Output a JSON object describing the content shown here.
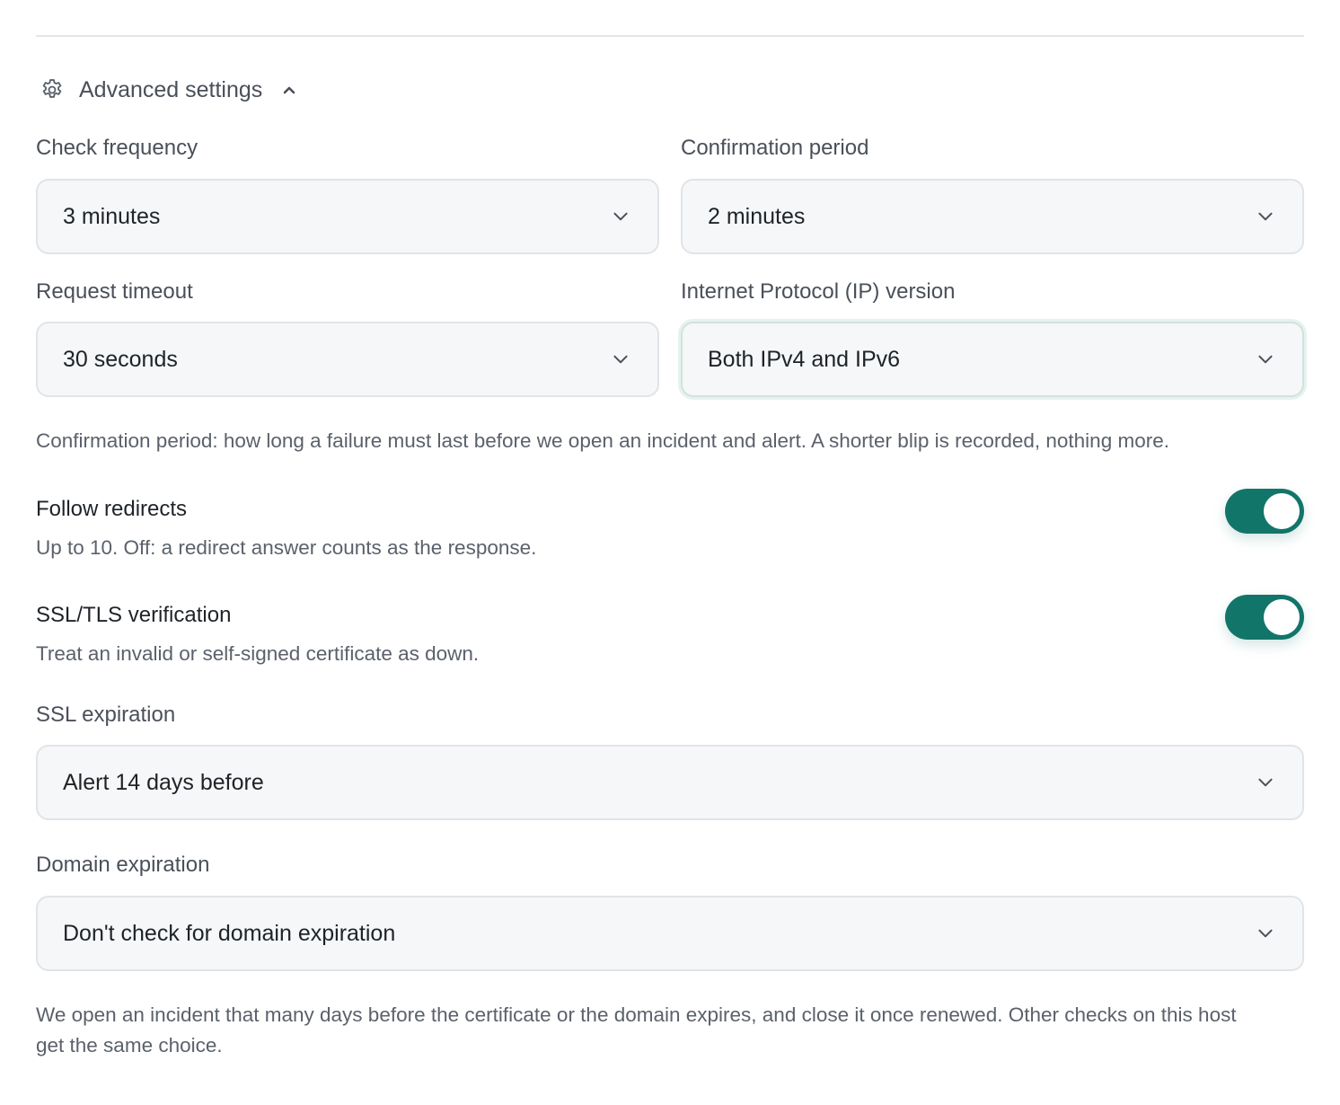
{
  "section": {
    "title": "Advanced settings",
    "expanded": true
  },
  "fields": {
    "check_frequency": {
      "label": "Check frequency",
      "value": "3 minutes"
    },
    "confirmation_period": {
      "label": "Confirmation period",
      "value": "2 minutes"
    },
    "request_timeout": {
      "label": "Request timeout",
      "value": "30 seconds"
    },
    "ip_version": {
      "label": "Internet Protocol (IP) version",
      "value": "Both IPv4 and IPv6"
    },
    "ssl_expiration": {
      "label": "SSL expiration",
      "value": "Alert 14 days before"
    },
    "domain_expiration": {
      "label": "Domain expiration",
      "value": "Don't check for domain expiration"
    }
  },
  "help": {
    "confirmation": "Confirmation period: how long a failure must last before we open an incident and alert. A shorter blip is recorded, nothing more.",
    "expiration_line1": "We open an incident that many days before the certificate or the domain expires, and close it once renewed. Other checks on this host",
    "expiration_line2": "get the same choice."
  },
  "toggles": {
    "follow_redirects": {
      "title": "Follow redirects",
      "description": "Up to 10. Off: a redirect answer counts as the response.",
      "on": true
    },
    "ssl_verification": {
      "title": "SSL/TLS verification",
      "description": "Treat an invalid or self-signed certificate as down.",
      "on": true
    }
  },
  "icons": {
    "section": "gear-icon",
    "collapse": "chevron-up-icon",
    "select": "chevron-down-icon"
  },
  "colors": {
    "toggle_on": "#127569",
    "field_bg": "#f5f7f8",
    "border": "#e1e4e8"
  }
}
